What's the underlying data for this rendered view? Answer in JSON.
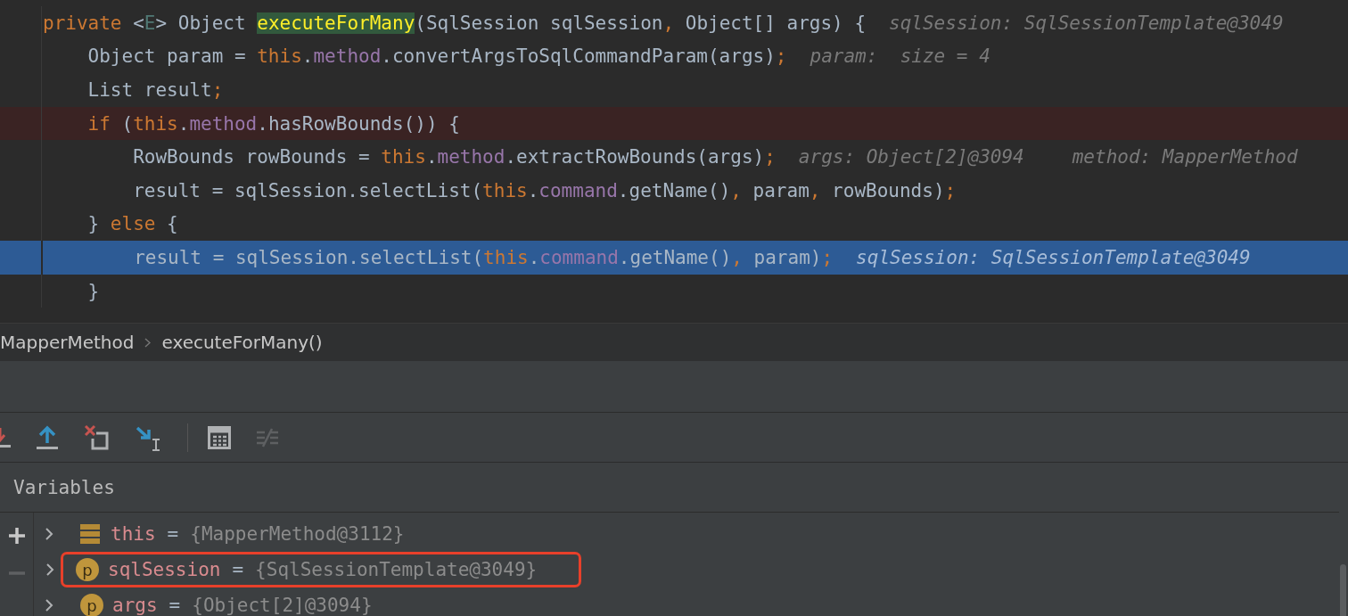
{
  "editor": {
    "lines": [
      {
        "kind": "normal",
        "code": [
          {
            "kind": "keyword",
            "text": "private "
          },
          {
            "kind": "code",
            "text": "<"
          },
          {
            "kind": "typeparam",
            "text": "E"
          },
          {
            "kind": "code",
            "text": "> Object "
          },
          {
            "kind": "match",
            "text": "executeForMany"
          },
          {
            "kind": "code",
            "text": "(SqlSession sqlSession"
          },
          {
            "kind": "punct",
            "text": ", "
          },
          {
            "kind": "code",
            "text": "Object[] args) {"
          }
        ],
        "hints": [
          "sqlSession: SqlSessionTemplate@3049"
        ]
      },
      {
        "kind": "normal",
        "code": [
          {
            "kind": "code",
            "text": "    Object param = "
          },
          {
            "kind": "keyword",
            "text": "this"
          },
          {
            "kind": "code",
            "text": "."
          },
          {
            "kind": "field",
            "text": "method"
          },
          {
            "kind": "code",
            "text": ".convertArgsToSqlCommandParam(args)"
          },
          {
            "kind": "punct",
            "text": ";"
          }
        ],
        "hints": [
          "param:  size = 4"
        ]
      },
      {
        "kind": "normal",
        "code": [
          {
            "kind": "code",
            "text": "    List result"
          },
          {
            "kind": "punct",
            "text": ";"
          }
        ]
      },
      {
        "kind": "breakpoint",
        "code": [
          {
            "kind": "keyword",
            "text": "    if "
          },
          {
            "kind": "code",
            "text": "("
          },
          {
            "kind": "keyword",
            "text": "this"
          },
          {
            "kind": "code",
            "text": "."
          },
          {
            "kind": "field",
            "text": "method"
          },
          {
            "kind": "code",
            "text": ".hasRowBounds()) {"
          }
        ]
      },
      {
        "kind": "normal",
        "code": [
          {
            "kind": "code",
            "text": "        RowBounds rowBounds = "
          },
          {
            "kind": "keyword",
            "text": "this"
          },
          {
            "kind": "code",
            "text": "."
          },
          {
            "kind": "field",
            "text": "method"
          },
          {
            "kind": "code",
            "text": ".extractRowBounds(args)"
          },
          {
            "kind": "punct",
            "text": ";"
          }
        ],
        "hints": [
          "args: Object[2]@3094",
          "method: MapperMethod"
        ]
      },
      {
        "kind": "normal",
        "code": [
          {
            "kind": "code",
            "text": "        result = sqlSession.selectList("
          },
          {
            "kind": "keyword",
            "text": "this"
          },
          {
            "kind": "code",
            "text": "."
          },
          {
            "kind": "field",
            "text": "command"
          },
          {
            "kind": "code",
            "text": ".getName()"
          },
          {
            "kind": "punct",
            "text": ", "
          },
          {
            "kind": "code",
            "text": "param"
          },
          {
            "kind": "punct",
            "text": ", "
          },
          {
            "kind": "code",
            "text": "rowBounds)"
          },
          {
            "kind": "punct",
            "text": ";"
          }
        ]
      },
      {
        "kind": "normal",
        "code": [
          {
            "kind": "code",
            "text": "    } "
          },
          {
            "kind": "keyword",
            "text": "else "
          },
          {
            "kind": "code",
            "text": "{"
          }
        ]
      },
      {
        "kind": "execution",
        "code": [
          {
            "kind": "code",
            "text": "        result = sqlSession.selectList("
          },
          {
            "kind": "keyword",
            "text": "this"
          },
          {
            "kind": "code",
            "text": "."
          },
          {
            "kind": "field",
            "text": "command"
          },
          {
            "kind": "code",
            "text": ".getName()"
          },
          {
            "kind": "punct",
            "text": ", "
          },
          {
            "kind": "code",
            "text": "param)"
          },
          {
            "kind": "punct",
            "text": ";"
          }
        ],
        "hints": [
          "sqlSession: SqlSessionTemplate@3049"
        ]
      },
      {
        "kind": "normal",
        "code": [
          {
            "kind": "code",
            "text": "    }"
          }
        ]
      }
    ]
  },
  "breadcrumb": [
    "MapperMethod",
    "executeForMany()"
  ],
  "debugger": {
    "tab": "Variables",
    "rows": [
      {
        "kind": "object",
        "name": "this",
        "operator": "=",
        "value": "{MapperMethod@3112}",
        "outlined": false
      },
      {
        "kind": "param",
        "badge": "p",
        "name": "sqlSession",
        "operator": "=",
        "value": "{SqlSessionTemplate@3049}",
        "outlined": true
      },
      {
        "kind": "param",
        "badge": "p",
        "name": "args",
        "operator": "=",
        "value": "{Object[2]@3094}",
        "outlined": false
      }
    ]
  }
}
